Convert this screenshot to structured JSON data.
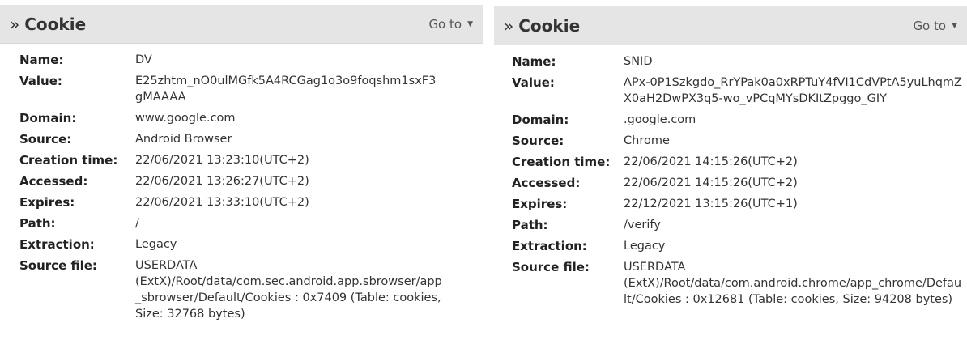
{
  "left_panel": {
    "title": "Cookie",
    "goto_label": "Go to",
    "fields": [
      {
        "label": "Name:",
        "value": "DV"
      },
      {
        "label": "Value:",
        "value": "E25zhtm_nO0ulMGfk5A4RCGag1o3o9foqshm1sxF3gMAAAA"
      },
      {
        "label": "Domain:",
        "value": "www.google.com"
      },
      {
        "label": "Source:",
        "value": "Android Browser"
      },
      {
        "label": "Creation time:",
        "value": "22/06/2021 13:23:10(UTC+2)"
      },
      {
        "label": "Accessed:",
        "value": "22/06/2021 13:26:27(UTC+2)"
      },
      {
        "label": "Expires:",
        "value": "22/06/2021 13:33:10(UTC+2)"
      },
      {
        "label": "Path:",
        "value": "/"
      },
      {
        "label": "Extraction:",
        "value": "Legacy"
      },
      {
        "label": "Source file:",
        "value": "USERDATA (ExtX)/Root/data/com.sec.android.app.sbrowser/app_sbrowser/Default/Cookies : 0x7409 (Table: cookies, Size: 32768 bytes)"
      }
    ]
  },
  "right_panel": {
    "title": "Cookie",
    "goto_label": "Go to",
    "fields": [
      {
        "label": "Name:",
        "value": "SNID"
      },
      {
        "label": "Value:",
        "value": "APx-0P1Szkgdo_RrYPak0a0xRPTuY4fVI1CdVPtA5yuLhqmZX0aH2DwPX3q5-wo_vPCqMYsDKItZpggo_GIY"
      },
      {
        "label": "Domain:",
        "value": ".google.com"
      },
      {
        "label": "Source:",
        "value": "Chrome"
      },
      {
        "label": "Creation time:",
        "value": "22/06/2021 14:15:26(UTC+2)"
      },
      {
        "label": "Accessed:",
        "value": "22/06/2021 14:15:26(UTC+2)"
      },
      {
        "label": "Expires:",
        "value": "22/12/2021 13:15:26(UTC+1)"
      },
      {
        "label": "Path:",
        "value": "/verify"
      },
      {
        "label": "Extraction:",
        "value": "Legacy"
      },
      {
        "label": "Source file:",
        "value": "USERDATA (ExtX)/Root/data/com.android.chrome/app_chrome/Default/Cookies : 0x12681 (Table: cookies, Size: 94208 bytes)"
      }
    ]
  }
}
